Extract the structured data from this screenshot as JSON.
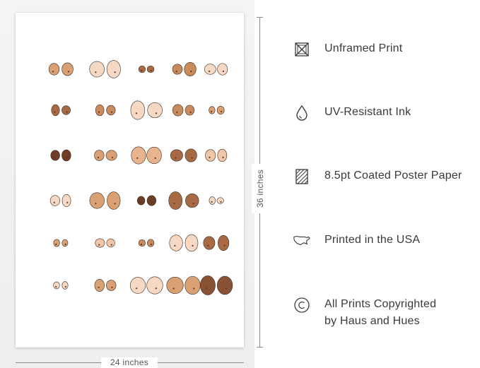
{
  "poster": {
    "art_description_icon": "illustrated-breasts-pattern",
    "width_label": "24 inches",
    "height_label": "36 inches"
  },
  "features": [
    {
      "icon": "unframed-icon",
      "label": "Unframed Print"
    },
    {
      "icon": "ink-drop-icon",
      "label": "UV-Resistant Ink"
    },
    {
      "icon": "paper-hatch-icon",
      "label": "8.5pt Coated Poster Paper"
    },
    {
      "icon": "usa-map-icon",
      "label": "Printed in the USA"
    },
    {
      "icon": "copyright-icon",
      "label_line1": "All Prints Copyrighted",
      "label_line2": "by Haus and Hues"
    }
  ],
  "colors": {
    "text": "#3a3a3a",
    "dimension_line": "#8a8a8a",
    "skin_tones": [
      "#f6d9c4",
      "#efc7a8",
      "#e8b48e",
      "#d9a074",
      "#c98a5c",
      "#a86a45",
      "#8a5234",
      "#6e3d26"
    ]
  }
}
